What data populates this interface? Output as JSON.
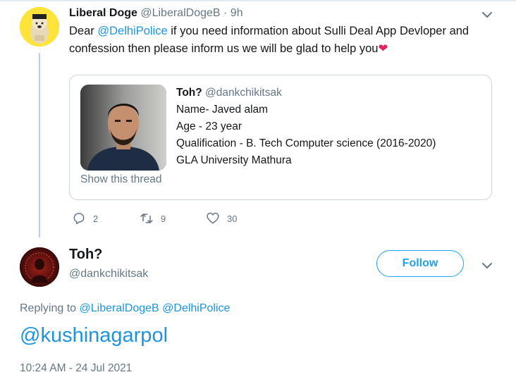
{
  "tweet1": {
    "author_name": "Liberal Doge",
    "author_handle": "@LiberalDogeB",
    "separator": "·",
    "time": "9h",
    "body_prefix": "Dear ",
    "mention": "@DelhiPolice",
    "body_suffix": " if you need information about Sulli Deal App Devloper and confession then please inform us we will be glad to help you",
    "emoji": "❤",
    "menu_icon": "chevron-down-icon",
    "quoted": {
      "author_name": "Toh?",
      "author_handle": "@dankchikitsak",
      "lines": [
        "Name- Javed alam",
        "Age - 23 year",
        "Qualification - B. Tech Computer science (2016-2020)",
        "GLA University Mathura"
      ],
      "show_thread": "Show this thread"
    },
    "actions": {
      "replies": "2",
      "retweets": "9",
      "likes": "30"
    }
  },
  "tweet2": {
    "author_name": "Toh?",
    "author_handle": "@dankchikitsak",
    "follow_label": "Follow",
    "replying_prefix": "Replying to ",
    "replying_to_1": "@LiberalDogeB",
    "replying_to_2": "@DelhiPolice",
    "body": "@kushinagarpol",
    "timestamp": "10:24 AM - 24 Jul 2021"
  },
  "colors": {
    "link": "#1b95e0",
    "muted": "#657786",
    "follow_blue": "#1da1f2",
    "heart": "#e0245e",
    "thread_line": "#b9cdf5"
  }
}
